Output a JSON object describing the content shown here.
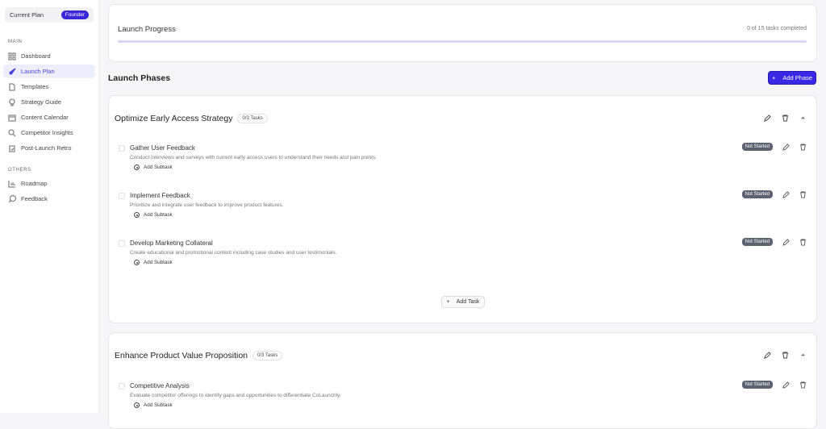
{
  "sidebar": {
    "plan_label": "Current Plan",
    "plan_badge": "Founder",
    "main_header": "MAIN",
    "others_header": "OTHERS",
    "main_items": [
      {
        "label": "Dashboard",
        "icon": "grid-icon"
      },
      {
        "label": "Launch Plan",
        "icon": "rocket-icon"
      },
      {
        "label": "Templates",
        "icon": "file-icon"
      },
      {
        "label": "Strategy Guide",
        "icon": "lightbulb-icon"
      },
      {
        "label": "Content Calendar",
        "icon": "calendar-icon"
      },
      {
        "label": "Competitor Insights",
        "icon": "search-icon"
      },
      {
        "label": "Post-Launch Retro",
        "icon": "clipboard-icon"
      }
    ],
    "other_items": [
      {
        "label": "Roadmap",
        "icon": "chart-icon"
      },
      {
        "label": "Feedback",
        "icon": "message-icon"
      }
    ]
  },
  "progress": {
    "title": "Launch Progress",
    "count": "0 of 15 tasks completed",
    "fraction": 0
  },
  "phases_title": "Launch Phases",
  "add_phase": "Add Phase",
  "add_task": "Add Task",
  "add_subtask": "Add Subtask",
  "phases": [
    {
      "title": "Optimize Early Access Strategy",
      "badge": "0/3 Tasks",
      "tasks": [
        {
          "title": "Gather User Feedback",
          "desc": "Conduct interviews and surveys with current early access users to understand their needs and pain points.",
          "status": "Not Started"
        },
        {
          "title": "Implement Feedback",
          "desc": "Prioritize and integrate user feedback to improve product features.",
          "status": "Not Started"
        },
        {
          "title": "Develop Marketing Collateral",
          "desc": "Create educational and promotional content including case studies and user testimonials.",
          "status": "Not Started"
        }
      ]
    },
    {
      "title": "Enhance Product Value Proposition",
      "badge": "0/3 Tasks",
      "tasks": [
        {
          "title": "Competitive Analysis",
          "desc": "Evaluate competitor offerings to identify gaps and opportunities to differentiate CoLaunchly.",
          "status": "Not Started"
        }
      ]
    }
  ]
}
